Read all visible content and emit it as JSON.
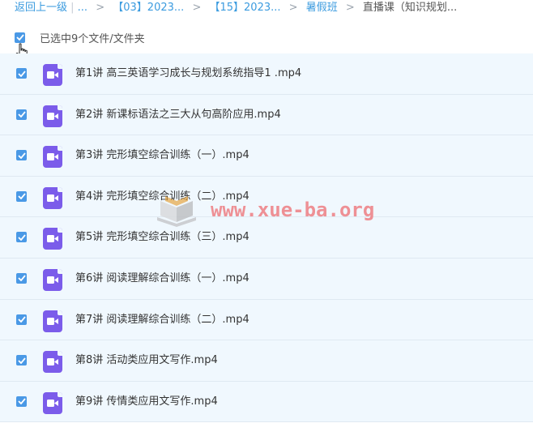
{
  "breadcrumb": {
    "back": "返回上一级",
    "ellipsis": "...",
    "items": [
      "【03】2023...",
      "【15】2023...",
      "暑假班"
    ],
    "current": "直播课（知识规划..."
  },
  "selection": {
    "text": "已选中9个文件/文件夹"
  },
  "files": [
    {
      "name": "第1讲 高三英语学习成长与规划系统指导1 .mp4",
      "checked": true
    },
    {
      "name": "第2讲 新课标语法之三大从句高阶应用.mp4",
      "checked": true
    },
    {
      "name": "第3讲 完形填空综合训练（一）.mp4",
      "checked": true
    },
    {
      "name": "第4讲 完形填空综合训练（二）.mp4",
      "checked": true
    },
    {
      "name": "第5讲 完形填空综合训练（三）.mp4",
      "checked": true
    },
    {
      "name": "第6讲 阅读理解综合训练（一）.mp4",
      "checked": true
    },
    {
      "name": "第7讲 阅读理解综合训练（二）.mp4",
      "checked": true
    },
    {
      "name": "第8讲 活动类应用文写作.mp4",
      "checked": true
    },
    {
      "name": "第9讲 传情类应用文写作.mp4",
      "checked": true
    }
  ],
  "watermark": {
    "text": "www.xue-ba.org"
  },
  "colors": {
    "accent": "#4a99e6",
    "video_icon": "#7b5cea",
    "row_bg": "#f0f8fe",
    "link": "#3b9bdf"
  }
}
